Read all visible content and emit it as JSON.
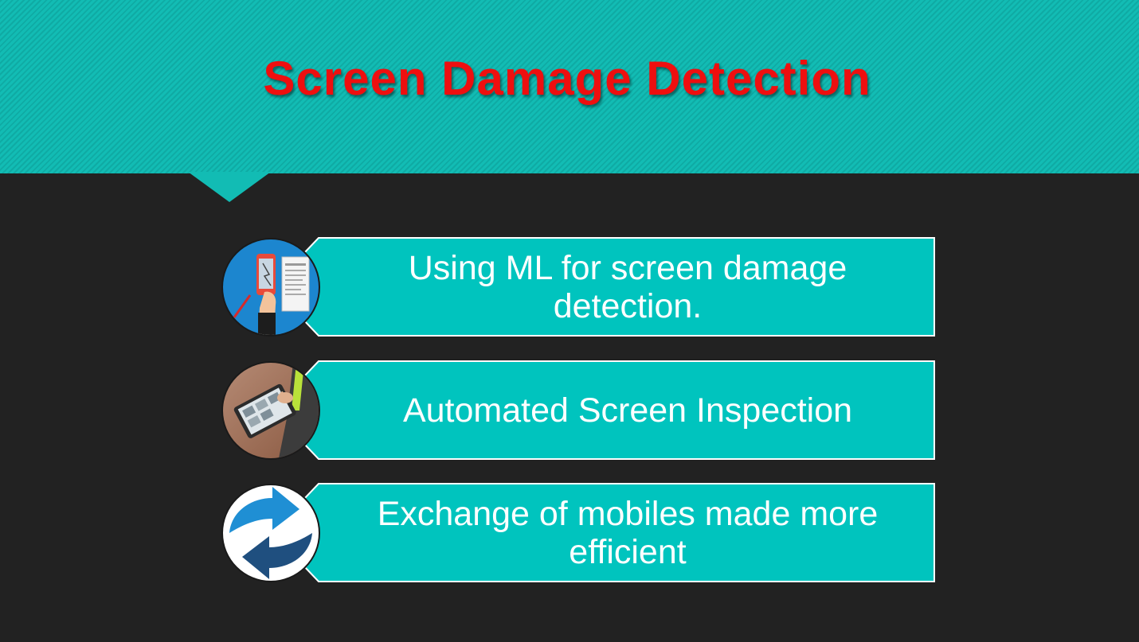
{
  "slide": {
    "title": "Screen Damage Detection",
    "colors": {
      "background": "#222222",
      "header": "#12bcb4",
      "box": "#00c4be",
      "title": "#ee0f0f",
      "box_text": "#ffffff"
    }
  },
  "items": [
    {
      "text": "Using ML for screen damage detection.",
      "icon": "phone-damage-report-icon"
    },
    {
      "text": "Automated Screen Inspection",
      "icon": "tablet-inspection-photo-icon"
    },
    {
      "text": "Exchange of mobiles made more efficient",
      "icon": "exchange-arrows-icon"
    }
  ]
}
